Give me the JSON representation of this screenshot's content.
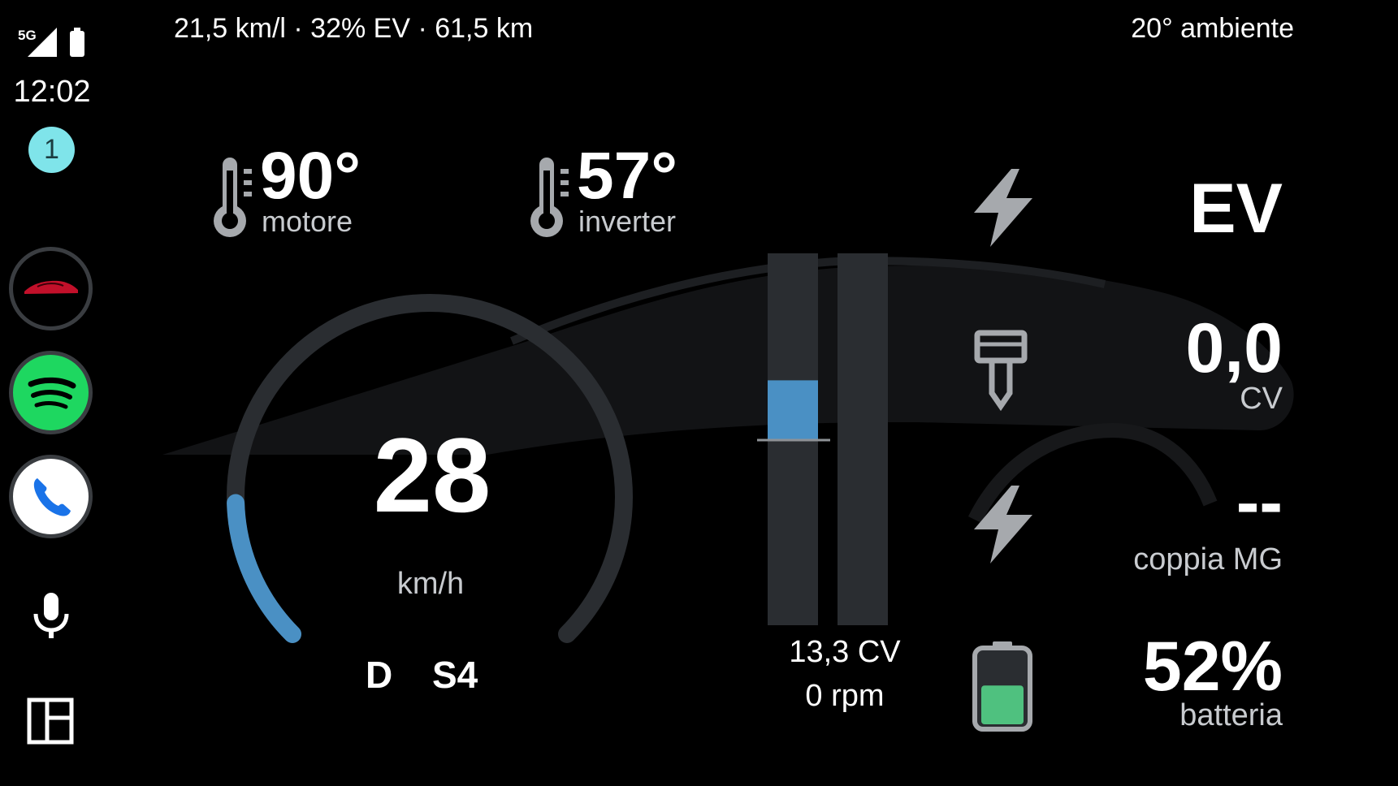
{
  "status": {
    "network": "5G",
    "time": "12:02",
    "notification_count": "1"
  },
  "rail": {
    "apps": [
      {
        "name": "car-app-icon"
      },
      {
        "name": "spotify-icon"
      },
      {
        "name": "phone-icon"
      }
    ]
  },
  "header": {
    "trip_summary": "21,5 km/l · 32% EV · 61,5 km",
    "ambient": "20° ambiente"
  },
  "temps": {
    "engine": {
      "value": "90°",
      "label": "motore"
    },
    "inverter": {
      "value": "57°",
      "label": "inverter"
    }
  },
  "speedometer": {
    "speed": "28",
    "unit": "km/h",
    "gear_mode": "D",
    "gear": "S4",
    "fill_fraction": 0.16
  },
  "power_bars": {
    "left_fill_fraction": 0.16,
    "power": "13,3 CV",
    "rpm": "0 rpm"
  },
  "right_panel": {
    "mode": "EV",
    "engine_power": {
      "value": "0,0",
      "label": "CV"
    },
    "mg_torque": {
      "value": "--",
      "label": "coppia MG"
    },
    "battery": {
      "value": "52%",
      "label": "batteria",
      "level_fraction": 0.52
    }
  },
  "colors": {
    "accent_blue": "#4a90c4",
    "battery_green": "#4fc17f",
    "notif_cyan": "#7fe4ea",
    "spotify_green": "#1ed760"
  }
}
